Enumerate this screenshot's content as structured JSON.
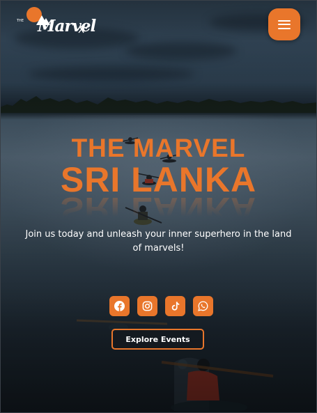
{
  "logo": {
    "word": "Marvel",
    "prefix": "THE"
  },
  "header": {
    "menu_icon": "hamburger-menu-icon"
  },
  "hero": {
    "title_line1": "THE MARVEL",
    "title_line2": "SRI LANKA",
    "tagline": "Join us today and unleash your inner superhero in the land of marvels!"
  },
  "socials": [
    {
      "icon": "facebook-icon"
    },
    {
      "icon": "instagram-icon"
    },
    {
      "icon": "tiktok-icon"
    },
    {
      "icon": "whatsapp-icon"
    }
  ],
  "cta": {
    "label": "Explore Events"
  },
  "colors": {
    "accent": "#e9762b",
    "text": "#ffffff"
  }
}
